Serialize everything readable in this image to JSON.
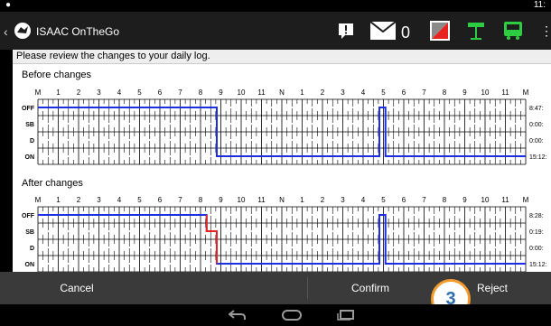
{
  "status_bar": {
    "left_icon": "location-pin-icon",
    "time": "11:"
  },
  "app": {
    "title": "ISAAC OnTheGo",
    "mail_count": "0",
    "icons": [
      "message-alert-icon",
      "mail-icon",
      "status-square-icon",
      "antenna-icon",
      "truck-icon"
    ]
  },
  "header": {
    "message": "Please review the changes to your daily log."
  },
  "before": {
    "label": "Before changes",
    "totals": [
      "8:47:",
      "0:00:",
      "0:00:",
      "15:12:"
    ]
  },
  "after": {
    "label": "After changes",
    "totals": [
      "8:28:",
      "0:19:",
      "0:00:",
      "15:12:"
    ]
  },
  "grid": {
    "hour_labels": [
      "M",
      "1",
      "2",
      "3",
      "4",
      "5",
      "6",
      "7",
      "8",
      "9",
      "10",
      "11",
      "N",
      "1",
      "2",
      "3",
      "4",
      "5",
      "6",
      "7",
      "8",
      "9",
      "10",
      "11",
      "M"
    ],
    "row_labels": [
      "OFF",
      "SB",
      "D",
      "ON"
    ]
  },
  "buttons": {
    "cancel": "Cancel",
    "confirm": "Confirm",
    "reject": "Reject"
  },
  "callout": {
    "number": "3"
  },
  "colors": {
    "line": "#1c2fe0",
    "change": "#e8231f",
    "callout_border": "#f39a2b",
    "callout_text": "#2c6fb1"
  }
}
